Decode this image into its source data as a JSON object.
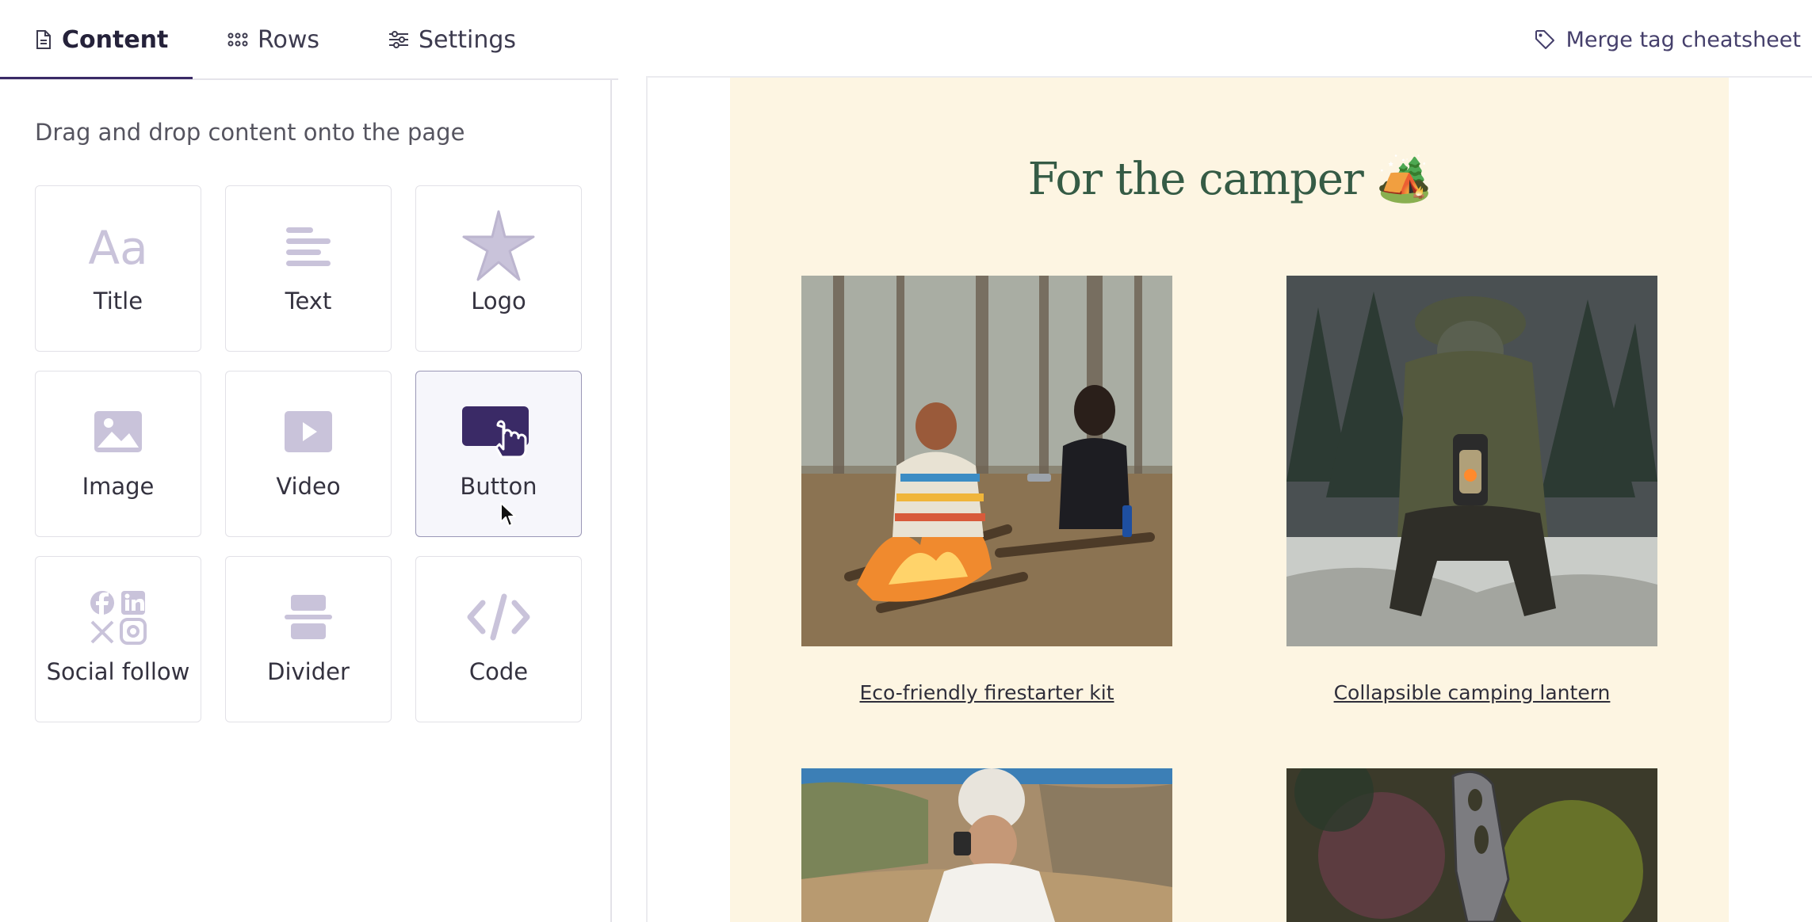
{
  "tabs": [
    {
      "label": "Content",
      "icon": "document-icon",
      "active": true
    },
    {
      "label": "Rows",
      "icon": "grid-dots-icon",
      "active": false
    },
    {
      "label": "Settings",
      "icon": "sliders-icon",
      "active": false
    }
  ],
  "merge_tag": {
    "label": "Merge tag cheatsheet",
    "icon": "tag-icon"
  },
  "panel": {
    "hint": "Drag and drop content onto the page",
    "blocks": [
      {
        "label": "Title",
        "icon": "title-aa-icon"
      },
      {
        "label": "Text",
        "icon": "text-lines-icon"
      },
      {
        "label": "Logo",
        "icon": "starfish-logo-icon"
      },
      {
        "label": "Image",
        "icon": "image-icon"
      },
      {
        "label": "Video",
        "icon": "video-play-icon"
      },
      {
        "label": "Button",
        "icon": "button-click-icon",
        "hovered": true
      },
      {
        "label": "Social follow",
        "icon": "social-icons-icon"
      },
      {
        "label": "Divider",
        "icon": "divider-icon"
      },
      {
        "label": "Code",
        "icon": "code-brackets-icon"
      }
    ]
  },
  "email": {
    "heading": "For the camper 🏕️",
    "products": [
      {
        "name": "Eco-friendly firestarter kit",
        "image": "campfire-photo"
      },
      {
        "name": "Collapsible camping lantern",
        "image": "lantern-photo"
      },
      {
        "name": "",
        "image": "mug-photo"
      },
      {
        "name": "",
        "image": "knife-tool-photo"
      }
    ]
  },
  "colors": {
    "accent": "#3a2a66",
    "icon_muted": "#c9c3da",
    "email_bg": "#fdf5e2",
    "heading_green": "#355b45"
  }
}
